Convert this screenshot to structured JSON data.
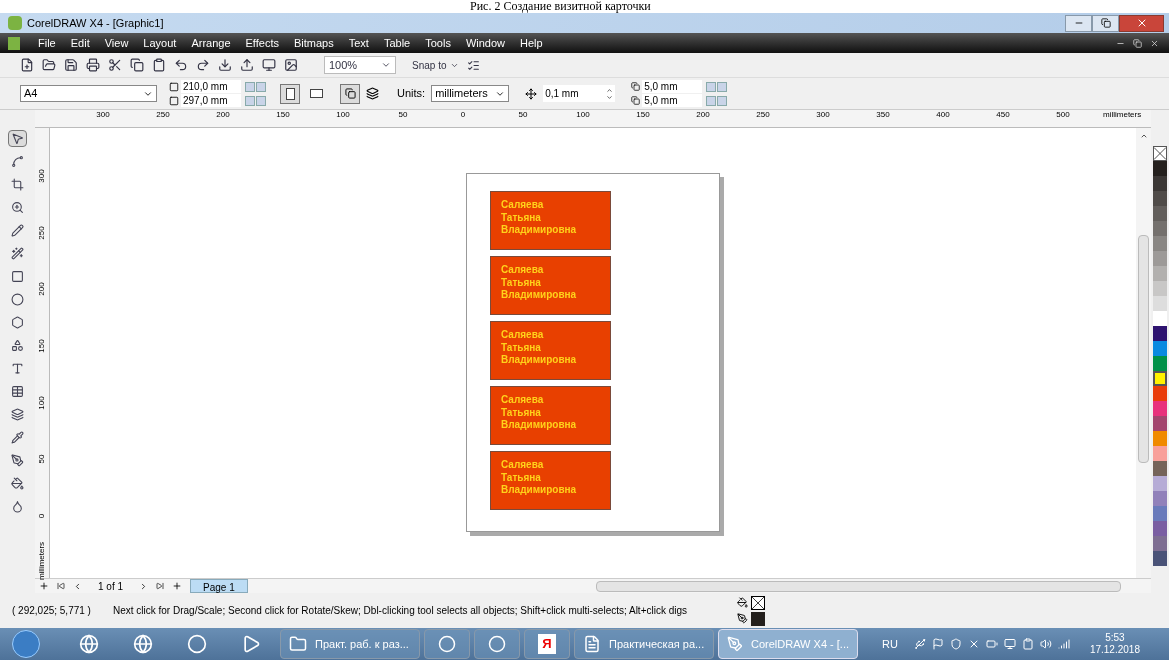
{
  "caption": "Рис. 2 Создание визитной карточки",
  "window": {
    "title": "CorelDRAW X4 - [Graphic1]"
  },
  "menu": [
    "File",
    "Edit",
    "View",
    "Layout",
    "Arrange",
    "Effects",
    "Bitmaps",
    "Text",
    "Table",
    "Tools",
    "Window",
    "Help"
  ],
  "toolbar": {
    "zoom": "100%",
    "snap": "Snap to"
  },
  "property_bar": {
    "paper": "A4",
    "width": "210,0 mm",
    "height": "297,0 mm",
    "orientation_portrait": true,
    "units_label": "Units:",
    "units": "millimeters",
    "nudge": "0,1 mm",
    "dup_x": "5,0 mm",
    "dup_y": "5,0 mm"
  },
  "ruler_h": [
    "300",
    "250",
    "200",
    "150",
    "100",
    "50",
    "0",
    "50",
    "100",
    "150",
    "200",
    "250",
    "300",
    "350",
    "400",
    "450",
    "500"
  ],
  "ruler_h_unit": "millimeters",
  "ruler_v": [
    "300",
    "250",
    "200",
    "150",
    "100",
    "50",
    "0"
  ],
  "ruler_v_unit": "millimeters",
  "toolbox": [
    {
      "kind": "pick",
      "selected": true
    },
    {
      "kind": "shape",
      "selected": false
    },
    {
      "kind": "crop",
      "selected": false
    },
    {
      "kind": "zoom",
      "selected": false
    },
    {
      "kind": "freehand",
      "selected": false
    },
    {
      "kind": "smartfill",
      "selected": false
    },
    {
      "kind": "rectangle",
      "selected": false
    },
    {
      "kind": "ellipse",
      "selected": false
    },
    {
      "kind": "polygon",
      "selected": false
    },
    {
      "kind": "shapes",
      "selected": false
    },
    {
      "kind": "text",
      "selected": false
    },
    {
      "kind": "table",
      "selected": false
    },
    {
      "kind": "blend",
      "selected": false
    },
    {
      "kind": "eyedropper",
      "selected": false
    },
    {
      "kind": "outline",
      "selected": false
    },
    {
      "kind": "fill",
      "selected": false
    },
    {
      "kind": "interactive_fill",
      "selected": false
    }
  ],
  "cards": [
    {
      "lines": [
        "Саляева",
        "Татьяна",
        "Владимировна"
      ]
    },
    {
      "lines": [
        "Саляева",
        "Татьяна",
        "Владимировна"
      ]
    },
    {
      "lines": [
        "Саляева",
        "Татьяна",
        "Владимировна"
      ]
    },
    {
      "lines": [
        "Саляева",
        "Татьяна",
        "Владимировна"
      ]
    },
    {
      "lines": [
        "Саляева",
        "Татьяна",
        "Владимировна"
      ]
    }
  ],
  "palette": [
    {
      "kind": "none",
      "selected": false
    },
    {
      "color": "#24201d",
      "selected": false
    },
    {
      "color": "#3b3735",
      "selected": false
    },
    {
      "color": "#4f4b48",
      "selected": false
    },
    {
      "color": "#625e5b",
      "selected": false
    },
    {
      "color": "#74706d",
      "selected": false
    },
    {
      "color": "#898683",
      "selected": false
    },
    {
      "color": "#9d9a98",
      "selected": false
    },
    {
      "color": "#b2b0ae",
      "selected": false
    },
    {
      "color": "#c8c7c6",
      "selected": false
    },
    {
      "color": "#dddddd",
      "selected": false
    },
    {
      "color": "#ffffff",
      "selected": false
    },
    {
      "color": "#2e1370",
      "selected": false
    },
    {
      "color": "#0a8ae0",
      "selected": false
    },
    {
      "color": "#009148",
      "selected": false
    },
    {
      "color": "#fff200",
      "selected": true
    },
    {
      "color": "#e93c0b",
      "selected": false
    },
    {
      "color": "#e8317c",
      "selected": false
    },
    {
      "color": "#a3456e",
      "selected": false
    },
    {
      "color": "#f08a00",
      "selected": false
    },
    {
      "color": "#f8a09a",
      "selected": false
    },
    {
      "color": "#75645a",
      "selected": false
    },
    {
      "color": "#b6acd6",
      "selected": false
    },
    {
      "color": "#9181ba",
      "selected": false
    },
    {
      "color": "#6a7bbb",
      "selected": false
    },
    {
      "color": "#7a5ea2",
      "selected": false
    },
    {
      "color": "#7e6e92",
      "selected": false
    },
    {
      "color": "#4a5378",
      "selected": false
    }
  ],
  "pages": {
    "counter": "1 of 1",
    "tabs": [
      {
        "label": "Page 1",
        "selected": true
      }
    ]
  },
  "status": {
    "coords": "( 292,025; 5,771 )",
    "hint": "Next click for Drag/Scale; Second click for Rotate/Skew; Dbl-clicking tool selects all objects; Shift+click multi-selects; Alt+click digs",
    "fill": {
      "kind": "none"
    },
    "outline": {
      "color": "#231f1c"
    }
  },
  "taskbar": {
    "pinned": [
      {
        "kind": "ie"
      },
      {
        "kind": "firefox"
      },
      {
        "kind": "chrome"
      },
      {
        "kind": "media"
      }
    ],
    "tasks": [
      {
        "kind": "folder",
        "label": "Практ. раб. к раз...",
        "selected": false
      },
      {
        "kind": "skype",
        "selected": false
      },
      {
        "kind": "yabrowser",
        "selected": false
      },
      {
        "kind": "yandex",
        "label": "Я",
        "selected": false
      },
      {
        "kind": "word",
        "label": "Практическая ра...",
        "selected": false
      },
      {
        "kind": "corel",
        "label": "CorelDRAW X4 - [...",
        "selected": true
      }
    ],
    "lang": "RU",
    "time": "5:53",
    "date": "17.12.2018"
  }
}
